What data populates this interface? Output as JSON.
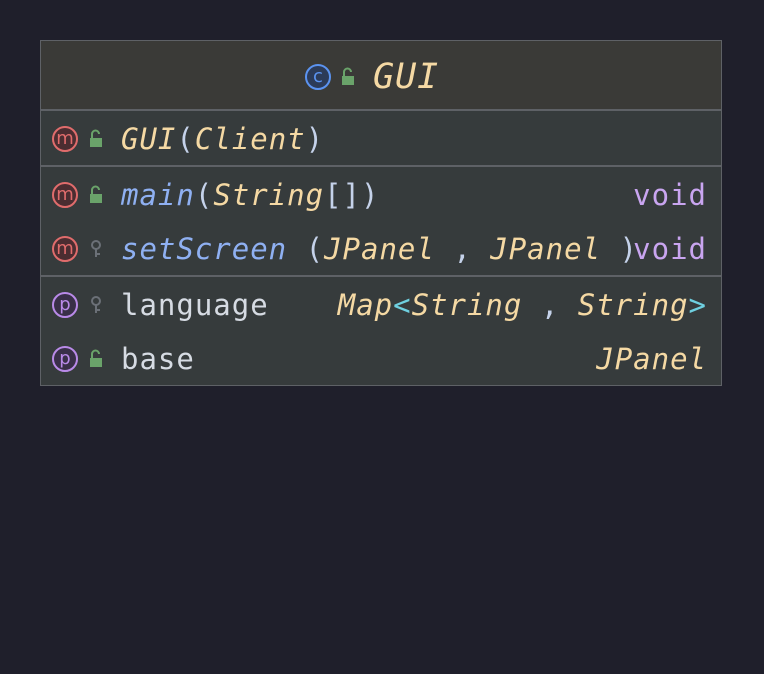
{
  "class": {
    "kind_badge": "c",
    "name": "GUI"
  },
  "constructors": [
    {
      "badge": "m",
      "visibility": "public",
      "name": "GUI",
      "open_paren": "(",
      "param_1": "Client",
      "close_paren": ")"
    }
  ],
  "methods": [
    {
      "badge": "m",
      "visibility": "public",
      "name": "main",
      "open_paren": "(",
      "param_1": "String",
      "brackets": "[]",
      "close_paren": ")",
      "return_type": "void"
    },
    {
      "badge": "m",
      "visibility": "private",
      "name": "setScreen",
      "open_paren": "(",
      "param_1": "JPanel",
      "comma": ",",
      "param_2": "JPanel",
      "close_paren": ")",
      "return_type": "void"
    }
  ],
  "properties": [
    {
      "badge": "p",
      "visibility": "private",
      "name": "language",
      "type_base": "Map",
      "lt": "<",
      "type_arg_1": "String",
      "comma": ",",
      "type_arg_2": "String",
      "gt": ">"
    },
    {
      "badge": "p",
      "visibility": "public",
      "name": "base",
      "type_base": "JPanel"
    }
  ],
  "colors": {
    "background": "#1f1f2b",
    "panel": "#363b3c",
    "method_badge": "#e06c6c",
    "property_badge": "#b98ae8",
    "class_badge": "#5b93f0",
    "public_lock": "#6aa36a",
    "private_key": "#6b7077"
  }
}
